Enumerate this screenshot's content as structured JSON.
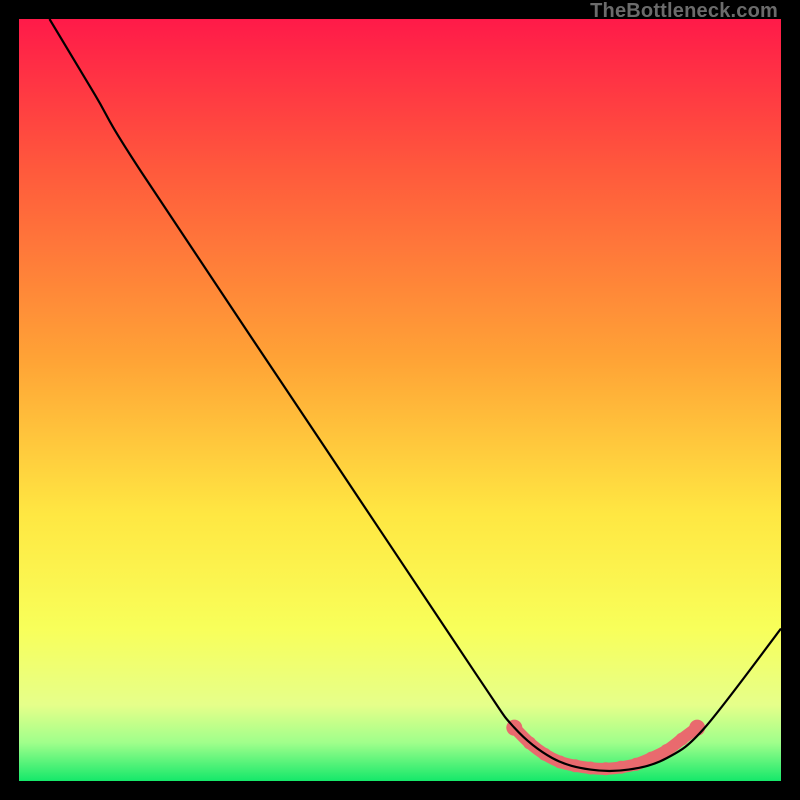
{
  "watermark": "TheBottleneck.com",
  "chart_data": {
    "type": "line",
    "title": "",
    "xlabel": "",
    "ylabel": "",
    "xlim": [
      0,
      100
    ],
    "ylim": [
      0,
      100
    ],
    "gradient_stops": [
      {
        "offset": 0,
        "color": "#ff1a49"
      },
      {
        "offset": 20,
        "color": "#ff5a3c"
      },
      {
        "offset": 45,
        "color": "#ffa436"
      },
      {
        "offset": 65,
        "color": "#ffe742"
      },
      {
        "offset": 80,
        "color": "#f8ff5a"
      },
      {
        "offset": 90,
        "color": "#e6ff8a"
      },
      {
        "offset": 95,
        "color": "#9fff8b"
      },
      {
        "offset": 100,
        "color": "#15e86a"
      }
    ],
    "series": [
      {
        "name": "bottleneck-curve",
        "color": "#000000",
        "points": [
          {
            "x": 4,
            "y": 100
          },
          {
            "x": 10,
            "y": 90
          },
          {
            "x": 16,
            "y": 80
          },
          {
            "x": 40,
            "y": 44
          },
          {
            "x": 60,
            "y": 14
          },
          {
            "x": 65,
            "y": 7
          },
          {
            "x": 70,
            "y": 3
          },
          {
            "x": 75,
            "y": 1.5
          },
          {
            "x": 80,
            "y": 1.5
          },
          {
            "x": 85,
            "y": 3
          },
          {
            "x": 90,
            "y": 7
          },
          {
            "x": 100,
            "y": 20
          }
        ]
      }
    ],
    "marker_band": {
      "name": "optimal-range",
      "color": "#e96a6e",
      "points": [
        {
          "x": 65,
          "y": 7.0
        },
        {
          "x": 67,
          "y": 5.0
        },
        {
          "x": 69,
          "y": 3.5
        },
        {
          "x": 71,
          "y": 2.5
        },
        {
          "x": 73,
          "y": 2.0
        },
        {
          "x": 75,
          "y": 1.7
        },
        {
          "x": 77,
          "y": 1.6
        },
        {
          "x": 79,
          "y": 1.8
        },
        {
          "x": 81,
          "y": 2.2
        },
        {
          "x": 83,
          "y": 3.0
        },
        {
          "x": 85,
          "y": 4.0
        },
        {
          "x": 87,
          "y": 5.5
        },
        {
          "x": 89,
          "y": 7.0
        }
      ]
    }
  }
}
